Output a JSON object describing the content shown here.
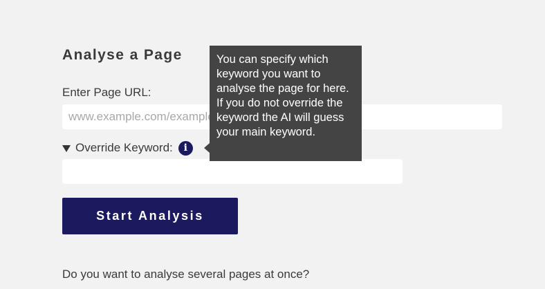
{
  "form": {
    "heading": "Analyse a Page",
    "url_label": "Enter Page URL:",
    "url_placeholder": "www.example.com/example",
    "url_value": "",
    "override_label": "Override Keyword:",
    "override_expanded": true,
    "info_icon_glyph": "i",
    "keyword_value": "",
    "start_button_label": "Start Analysis",
    "several_pages_text": "Do you want to analyse several pages at once?"
  },
  "tooltip": {
    "text": "You can specify which keyword you want to analyse the page for here. If you do not override the keyword the AI will guess your main keyword."
  },
  "icons": {
    "expand": "triangle-down-icon",
    "info": "info-icon"
  },
  "colors": {
    "accent": "#1b1a5e",
    "background": "#f2f2f2",
    "tooltip_bg": "#444444",
    "input_bg": "#ffffff"
  }
}
